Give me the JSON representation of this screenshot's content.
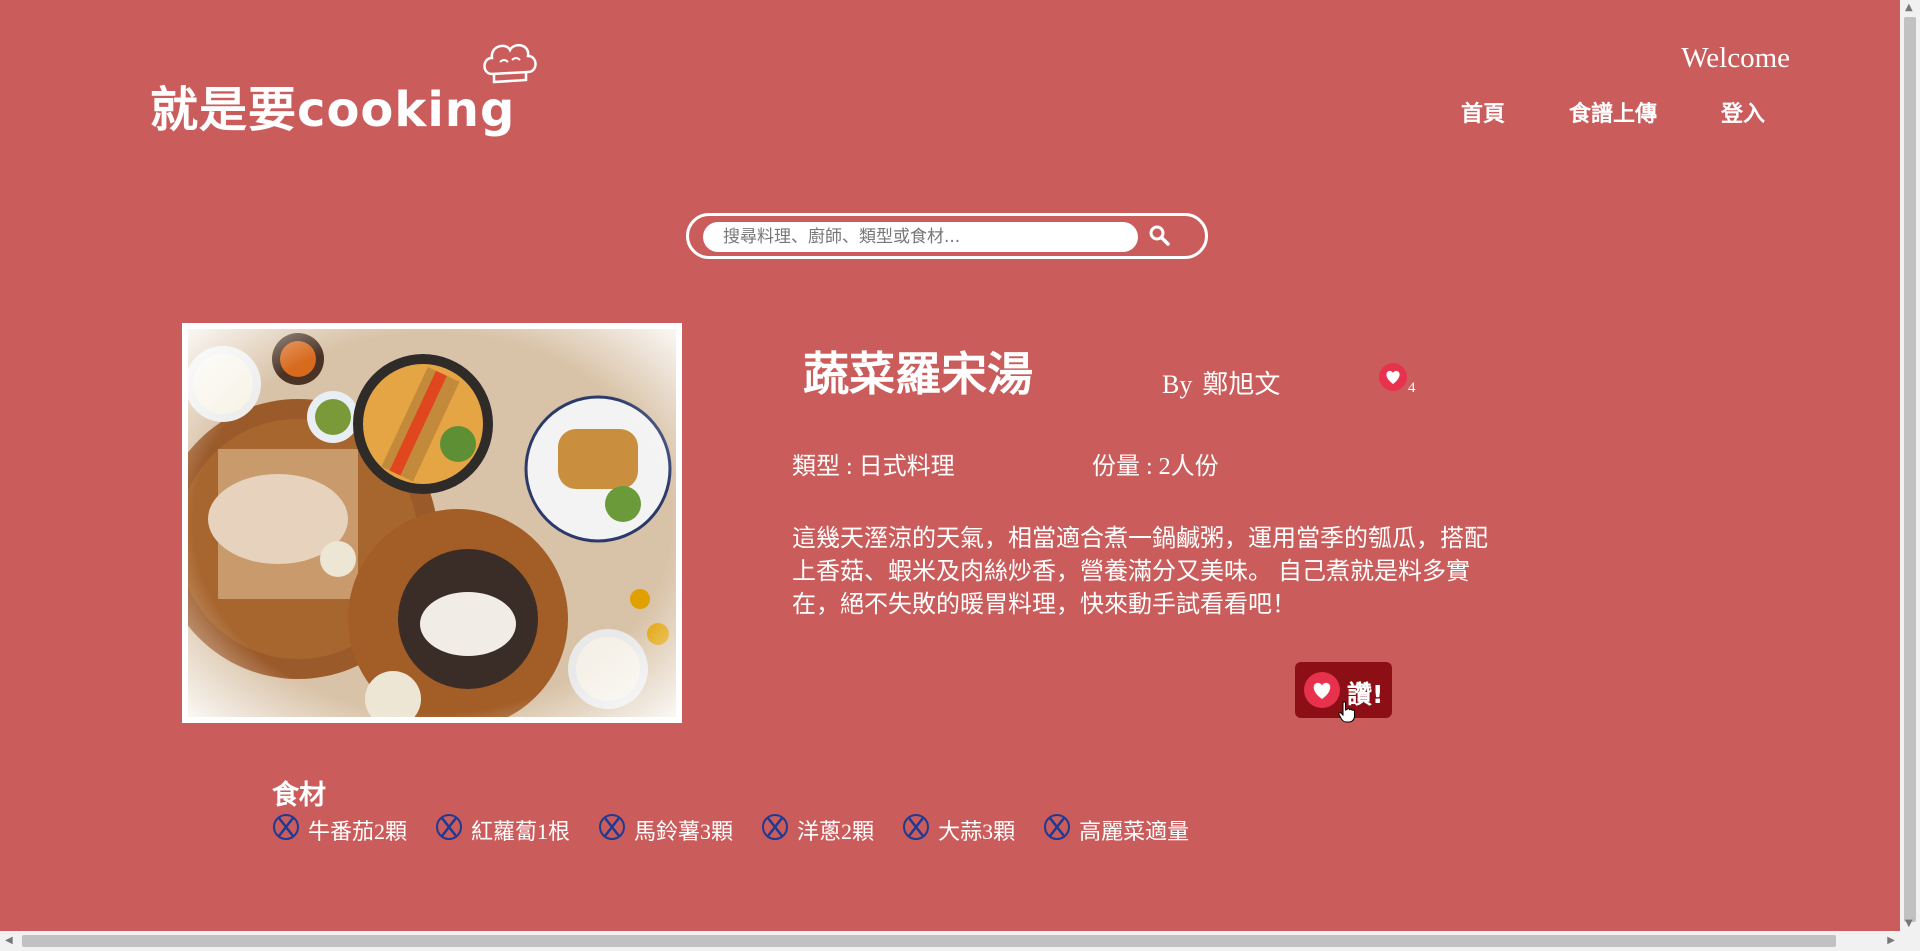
{
  "header": {
    "logo_text": "就是要cooking",
    "welcome": "Welcome",
    "nav": [
      {
        "label": "首頁"
      },
      {
        "label": "食譜上傳"
      },
      {
        "label": "登入"
      }
    ]
  },
  "search": {
    "placeholder": "搜尋料理、廚師、類型或食材...",
    "value": ""
  },
  "recipe": {
    "title": "蔬菜羅宋湯",
    "by_label": "By",
    "author": "鄭旭文",
    "like_count": "4",
    "type_label": "類型 : 日式料理",
    "serving_label": "份量 : 2人份",
    "description": "這幾天溼涼的天氣，相當適合煮一鍋鹹粥，運用當季的瓠瓜，搭配上香菇、蝦米及肉絲炒香，營養滿分又美味。 自己煮就是料多實在，絕不失敗的暖胃料理，快來動手試看看吧！",
    "like_button_label": "讚!"
  },
  "ingredients": {
    "heading": "食材",
    "items": [
      {
        "label": "牛番茄2顆"
      },
      {
        "label": "紅蘿蔔1根"
      },
      {
        "label": "馬鈴薯3顆"
      },
      {
        "label": "洋蔥2顆"
      },
      {
        "label": "大蒜3顆"
      },
      {
        "label": "高麗菜適量"
      }
    ]
  },
  "colors": {
    "background": "#cb5c5c",
    "like_button": "#8b0f14",
    "heart": "#e8324d",
    "ingredient_icon": "#1f3a93"
  },
  "icons": {
    "chef_hat": "chef-hat-icon",
    "search": "search-icon",
    "heart": "heart-icon",
    "ingredient": "utensils-icon"
  }
}
